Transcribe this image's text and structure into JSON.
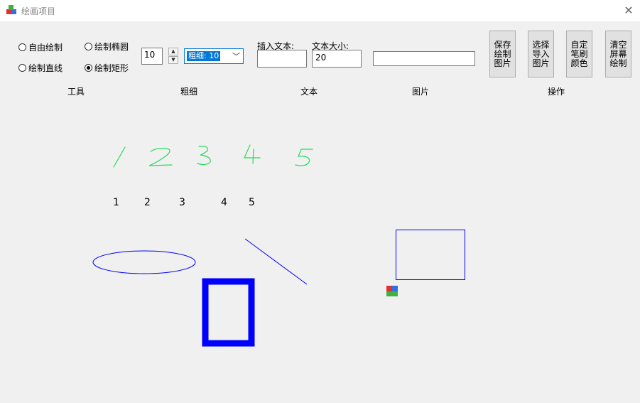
{
  "window": {
    "title": "绘画项目"
  },
  "tools": {
    "free_draw": "自由绘制",
    "ellipse": "绘制椭圆",
    "line": "绘制直线",
    "rect": "绘制矩形",
    "selected": "rect"
  },
  "thickness": {
    "stepper_value": "10",
    "select_value": "粗细: 10"
  },
  "text_input": {
    "label": "插入文本:",
    "value": ""
  },
  "text_size": {
    "label": "文本大小:",
    "value": "20"
  },
  "image_path": {
    "value": ""
  },
  "buttons": {
    "save": [
      "保存",
      "绘制",
      "图片"
    ],
    "import": [
      "选择",
      "导入",
      "图片"
    ],
    "color": [
      "自定",
      "笔刷",
      "颜色"
    ],
    "clear": [
      "清空",
      "屏幕",
      "绘制"
    ]
  },
  "sections": {
    "tools": "工具",
    "thickness": "粗细",
    "text": "文本",
    "image": "图片",
    "actions": "操作"
  },
  "canvas": {
    "handwritten": [
      "1",
      "2",
      "3",
      "4",
      "5"
    ],
    "typed": [
      "1",
      "2",
      "3",
      "4",
      "5"
    ]
  },
  "colors": {
    "accent": "#0078d7",
    "shape_blue": "#0000ff",
    "handwriting_green": "#22dd55"
  }
}
